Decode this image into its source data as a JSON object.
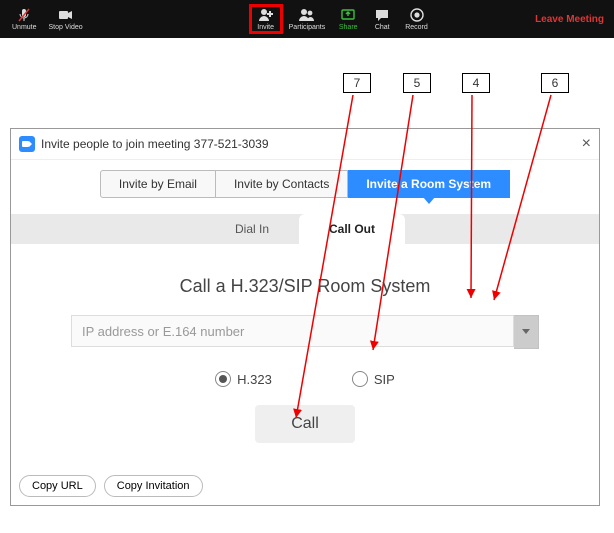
{
  "toolbar": {
    "unmute": "Unmute",
    "stop_video": "Stop Video",
    "invite": "Invite",
    "participants": "Participants",
    "share": "Share",
    "chat": "Chat",
    "record": "Record",
    "leave": "Leave Meeting"
  },
  "annotations": {
    "a7": "7",
    "a5": "5",
    "a4": "4",
    "a6": "6"
  },
  "dialog": {
    "title": "Invite people to join meeting 377-521-3039",
    "methods": {
      "email": "Invite by Email",
      "contacts": "Invite by Contacts",
      "room": "Invite a Room System"
    },
    "tabs": {
      "dial_in": "Dial In",
      "call_out": "Call Out"
    },
    "section_title": "Call a H.323/SIP Room System",
    "ip_placeholder": "IP address or E.164 number",
    "ip_value": "",
    "protocols": {
      "h323": "H.323",
      "sip": "SIP"
    },
    "selected_protocol": "h323",
    "call_label": "Call",
    "footer": {
      "copy_url": "Copy URL",
      "copy_invitation": "Copy Invitation"
    }
  }
}
